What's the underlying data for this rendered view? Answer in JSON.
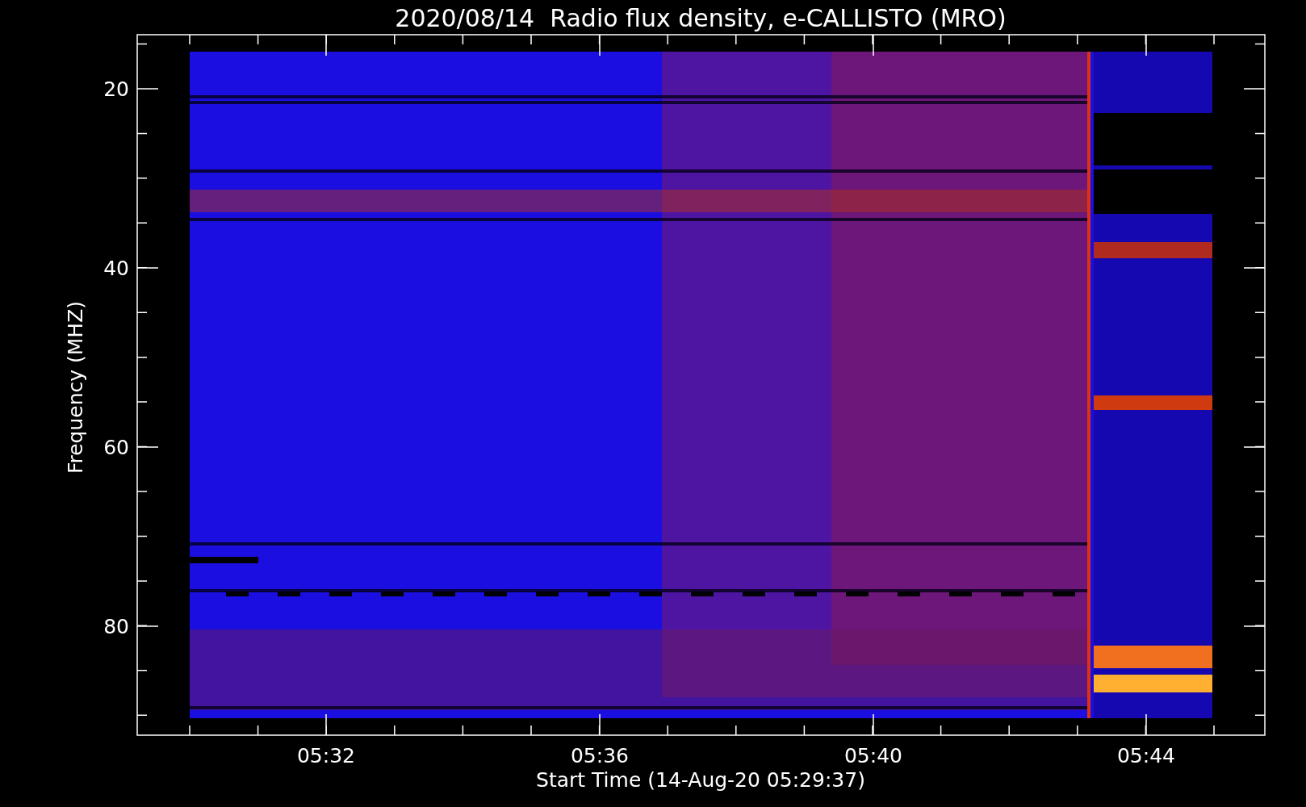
{
  "title": "2020/08/14  Radio flux density, e-CALLISTO (MRO)",
  "y_axis": {
    "label": "Frequency (MHZ)",
    "tick_labels": [
      "20",
      "40",
      "60",
      "80"
    ]
  },
  "x_axis": {
    "label": "Start Time (14-Aug-20 05:29:37)",
    "tick_labels": [
      "05:32",
      "05:36",
      "05:40",
      "05:44"
    ]
  }
}
